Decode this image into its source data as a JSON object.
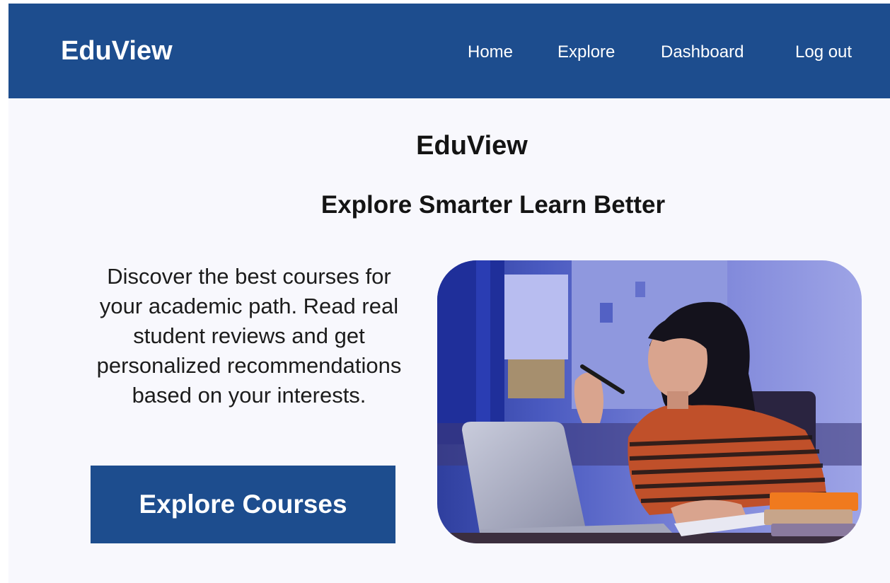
{
  "header": {
    "brand": "EduView",
    "nav": [
      {
        "label": "Home"
      },
      {
        "label": "Explore"
      },
      {
        "label": "Dashboard"
      },
      {
        "label": "Log out"
      }
    ]
  },
  "hero": {
    "title": "EduView",
    "subtitle": "Explore Smarter Learn Better",
    "description": "Discover the best courses for your academic path. Read real student reviews and get personalized recommendations based on your interests.",
    "cta_label": "Explore Courses",
    "image": {
      "subject": "student-studying-with-laptop-photo"
    }
  },
  "colors": {
    "nav_background": "#1d4d8e",
    "page_background": "#f8f8fd",
    "button_background": "#1d4d8e",
    "text": "#141414"
  }
}
